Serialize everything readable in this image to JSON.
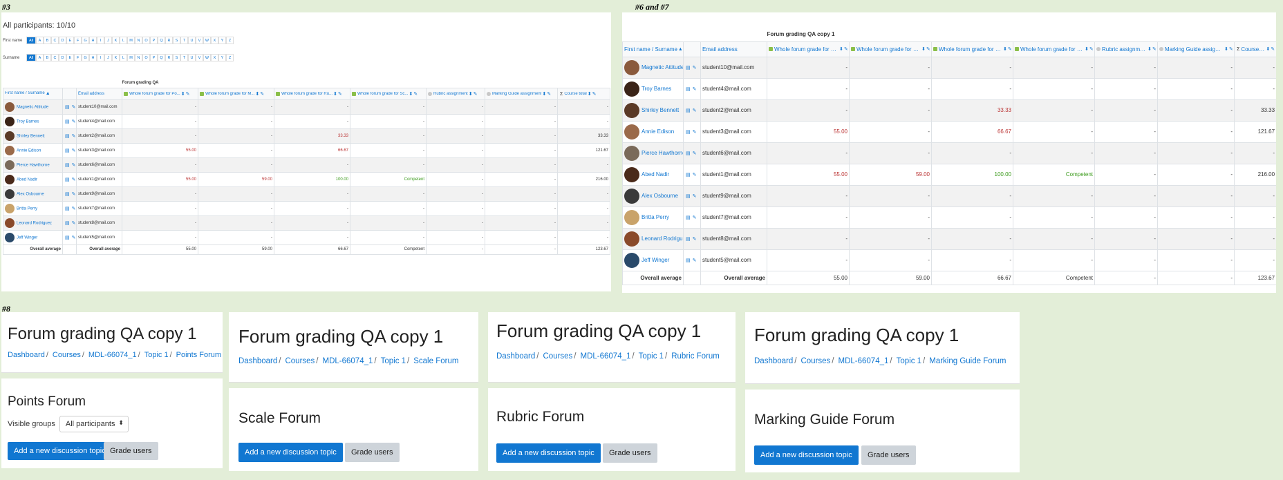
{
  "labels": {
    "l3": "#3",
    "l67": "#6 and #7",
    "l8": "#8"
  },
  "grader": {
    "participants": "All participants: 10/10",
    "firstname_label": "First name",
    "surname_label": "Surname",
    "letters": [
      "All",
      "A",
      "B",
      "C",
      "D",
      "E",
      "F",
      "G",
      "H",
      "I",
      "J",
      "K",
      "L",
      "M",
      "N",
      "O",
      "P",
      "Q",
      "R",
      "S",
      "T",
      "U",
      "V",
      "W",
      "X",
      "Y",
      "Z"
    ],
    "group_heading": "Forum grading QA",
    "group_heading_67": "Forum grading QA copy 1",
    "columns": {
      "name": "First name / Surname",
      "email": "Email address",
      "points": "Whole forum grade for Po...",
      "scale": "Whole forum grade for M...",
      "rubric": "Whole forum grade for Ru...",
      "marking": "Whole forum grade for Sc...",
      "rubric_assign": "Rubric assignment",
      "marking_assign": "Marking Guide assignment",
      "total": "Course total"
    },
    "rows": [
      {
        "name": "Magnetic Attitude",
        "email": "student10@mail.com",
        "c1": "-",
        "c2": "-",
        "c3": "-",
        "c4": "-",
        "c5": "-",
        "c6": "-",
        "total": "-"
      },
      {
        "name": "Troy Barnes",
        "email": "student4@mail.com",
        "c1": "-",
        "c2": "-",
        "c3": "-",
        "c4": "-",
        "c5": "-",
        "c6": "-",
        "total": "-"
      },
      {
        "name": "Shirley Bennett",
        "email": "student2@mail.com",
        "c1": "-",
        "c2": "-",
        "c3": "33.33",
        "c4": "-",
        "c5": "-",
        "c6": "-",
        "total": "33.33"
      },
      {
        "name": "Annie Edison",
        "email": "student3@mail.com",
        "c1": "55.00",
        "c2": "-",
        "c3": "66.67",
        "c4": "-",
        "c5": "-",
        "c6": "-",
        "total": "121.67"
      },
      {
        "name": "Pierce Hawthorne",
        "email": "student6@mail.com",
        "c1": "-",
        "c2": "-",
        "c3": "-",
        "c4": "-",
        "c5": "-",
        "c6": "-",
        "total": "-"
      },
      {
        "name": "Abed Nadir",
        "email": "student1@mail.com",
        "c1": "55.00",
        "c2": "59.00",
        "c3": "100.00",
        "c4": "Competent",
        "c5": "-",
        "c6": "-",
        "total": "216.00"
      },
      {
        "name": "Alex Osbourne",
        "email": "student9@mail.com",
        "c1": "-",
        "c2": "-",
        "c3": "-",
        "c4": "-",
        "c5": "-",
        "c6": "-",
        "total": "-"
      },
      {
        "name": "Britta Perry",
        "email": "student7@mail.com",
        "c1": "-",
        "c2": "-",
        "c3": "-",
        "c4": "-",
        "c5": "-",
        "c6": "-",
        "total": "-"
      },
      {
        "name": "Leonard Rodriguez",
        "email": "student8@mail.com",
        "c1": "-",
        "c2": "-",
        "c3": "-",
        "c4": "-",
        "c5": "-",
        "c6": "-",
        "total": "-"
      },
      {
        "name": "Jeff Winger",
        "email": "student5@mail.com",
        "c1": "-",
        "c2": "-",
        "c3": "-",
        "c4": "-",
        "c5": "-",
        "c6": "-",
        "total": "-"
      }
    ],
    "avg": {
      "label": "Overall average",
      "c1": "55.00",
      "c2": "59.00",
      "c3": "66.67",
      "c4": "Competent",
      "c5": "-",
      "c6": "-",
      "total": "123.67"
    }
  },
  "cards": [
    {
      "title": "Forum grading QA copy 1",
      "crumbs": [
        "Dashboard",
        "Courses",
        "MDL-66074_1",
        "Topic 1",
        "Points Forum"
      ],
      "forum": "Points Forum",
      "visible_groups": "Visible groups",
      "group_value": "All participants",
      "add": "Add a new discussion topic",
      "grade": "Grade users"
    },
    {
      "title": "Forum grading QA copy 1",
      "crumbs": [
        "Dashboard",
        "Courses",
        "MDL-66074_1",
        "Topic 1",
        "Scale Forum"
      ],
      "forum": "Scale Forum",
      "add": "Add a new discussion topic",
      "grade": "Grade users"
    },
    {
      "title": "Forum grading QA copy 1",
      "crumbs": [
        "Dashboard",
        "Courses",
        "MDL-66074_1",
        "Topic 1",
        "Rubric Forum"
      ],
      "forum": "Rubric Forum",
      "add": "Add a new discussion topic",
      "grade": "Grade users"
    },
    {
      "title": "Forum grading QA copy 1",
      "crumbs": [
        "Dashboard",
        "Courses",
        "MDL-66074_1",
        "Topic 1",
        "Marking Guide Forum"
      ],
      "forum": "Marking Guide Forum",
      "add": "Add a new discussion topic",
      "grade": "Grade users"
    }
  ],
  "colors": {
    "accent": "#1177d1",
    "red": "#bb3333",
    "green": "#3a9a1a",
    "bg": "#e3eed8"
  }
}
